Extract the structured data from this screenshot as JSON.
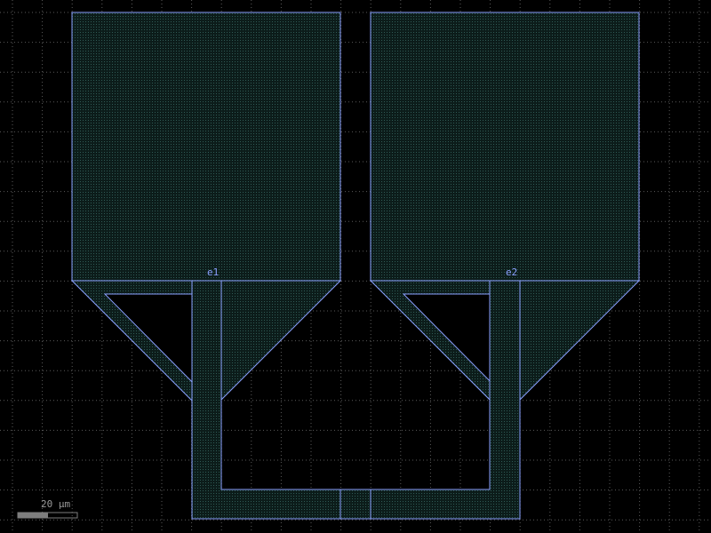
{
  "colors": {
    "background": "#000000",
    "grid": "#5a5a5a",
    "outline": "#8aa0ff",
    "fill": "#1f3f3a",
    "scalebar": "#7d7d7d",
    "label": "#8aa0ff",
    "scale_text": "#9a9a9a"
  },
  "ports": {
    "p1": "e1",
    "p2": "e2"
  },
  "scale_bar": {
    "label": "20 µm"
  }
}
